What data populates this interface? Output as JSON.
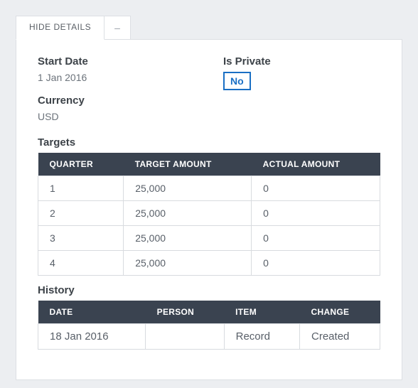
{
  "tabs": {
    "hideDetails": "HIDE DETAILS",
    "minus": "–"
  },
  "fields": {
    "startDate": {
      "label": "Start Date",
      "value": "1 Jan 2016"
    },
    "currency": {
      "label": "Currency",
      "value": "USD"
    },
    "isPrivate": {
      "label": "Is Private",
      "value": "No"
    }
  },
  "targets": {
    "title": "Targets",
    "headers": {
      "quarter": "QUARTER",
      "target": "TARGET AMOUNT",
      "actual": "ACTUAL AMOUNT"
    },
    "rows": [
      {
        "quarter": "1",
        "target": "25,000",
        "actual": "0"
      },
      {
        "quarter": "2",
        "target": "25,000",
        "actual": "0"
      },
      {
        "quarter": "3",
        "target": "25,000",
        "actual": "0"
      },
      {
        "quarter": "4",
        "target": "25,000",
        "actual": "0"
      }
    ]
  },
  "history": {
    "title": "History",
    "headers": {
      "date": "DATE",
      "person": "PERSON",
      "item": "ITEM",
      "change": "CHANGE"
    },
    "rows": [
      {
        "date": "18 Jan 2016",
        "person": "",
        "item": "Record",
        "change": "Created"
      }
    ]
  }
}
